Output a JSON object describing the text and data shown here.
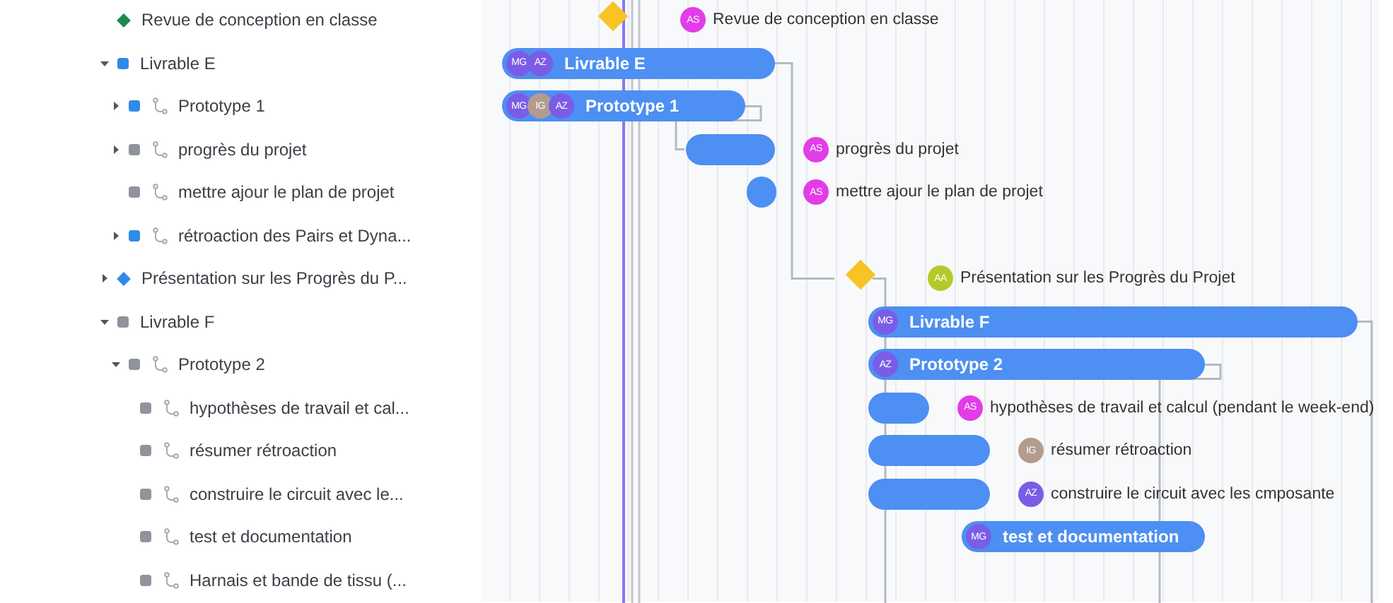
{
  "tree": [
    {
      "label": "Revue de conception en classe",
      "kind": "milestone",
      "color": "#1f8a4c"
    },
    {
      "label": "Livrable E",
      "kind": "group",
      "color": "#2e8be8",
      "expanded": true,
      "children": [
        {
          "label": "Prototype 1",
          "kind": "task",
          "color": "#2e8be8",
          "expanded": false
        },
        {
          "label": "progrès du projet",
          "kind": "task",
          "color": "#8f939b",
          "expanded": false
        },
        {
          "label": "mettre ajour le plan de projet",
          "kind": "task",
          "color": "#8f939b"
        },
        {
          "label": "rétroaction des Pairs et Dyna...",
          "kind": "task",
          "color": "#2e8be8",
          "expanded": false
        }
      ]
    },
    {
      "label": "Présentation sur les Progrès du P...",
      "kind": "milestone",
      "color": "#2e8be8",
      "expanded": false
    },
    {
      "label": "Livrable F",
      "kind": "group",
      "color": "#8f939b",
      "expanded": true,
      "children": [
        {
          "label": "Prototype 2",
          "kind": "task",
          "color": "#8f939b",
          "expanded": true,
          "children": [
            {
              "label": "hypothèses de travail et cal...",
              "kind": "task",
              "color": "#8f939b"
            },
            {
              "label": "résumer rétroaction",
              "kind": "task",
              "color": "#8f939b"
            },
            {
              "label": "construire le circuit avec le...",
              "kind": "task",
              "color": "#8f939b"
            },
            {
              "label": "test et documentation",
              "kind": "task",
              "color": "#8f939b"
            },
            {
              "label": "Harnais et bande de tissu (...",
              "kind": "task",
              "color": "#8f939b"
            }
          ]
        }
      ]
    }
  ],
  "timeline": {
    "rows": [
      {
        "kind": "milestone",
        "label": "Revue de conception en classe",
        "avatars": [
          {
            "initials": "AS",
            "color": "#e23de8"
          }
        ]
      },
      {
        "kind": "summary",
        "label": "Livrable E",
        "avatars": [
          {
            "initials": "MG",
            "color": "#7a5de6"
          },
          {
            "initials": "AZ",
            "color": "#7a5de6"
          }
        ]
      },
      {
        "kind": "summary",
        "label": "Prototype 1",
        "avatars": [
          {
            "initials": "MG",
            "color": "#7a5de6"
          },
          {
            "initials": "IG",
            "color": "#b39c8e"
          },
          {
            "initials": "AZ",
            "color": "#7a5de6"
          }
        ]
      },
      {
        "kind": "bar",
        "label": "progrès du projet",
        "avatars": [
          {
            "initials": "AS",
            "color": "#e23de8"
          }
        ]
      },
      {
        "kind": "dot",
        "label": "mettre ajour le plan de projet",
        "avatars": [
          {
            "initials": "AS",
            "color": "#e23de8"
          }
        ]
      },
      {
        "kind": "empty"
      },
      {
        "kind": "milestone",
        "label": "Présentation sur les Progrès du Projet",
        "avatars": [
          {
            "initials": "AA",
            "color": "#b5c92b"
          }
        ]
      },
      {
        "kind": "summary",
        "label": "Livrable F",
        "avatars": [
          {
            "initials": "MG",
            "color": "#7a5de6"
          }
        ]
      },
      {
        "kind": "summary",
        "label": "Prototype 2",
        "avatars": [
          {
            "initials": "AZ",
            "color": "#7a5de6"
          }
        ]
      },
      {
        "kind": "bar",
        "label": "hypothèses de travail et calcul (pendant le week-end)",
        "avatars": [
          {
            "initials": "AS",
            "color": "#e23de8"
          }
        ]
      },
      {
        "kind": "bar",
        "label": "résumer rétroaction",
        "avatars": [
          {
            "initials": "IG",
            "color": "#b39c8e"
          }
        ]
      },
      {
        "kind": "bar",
        "label": "construire le circuit avec les cmposante",
        "avatars": [
          {
            "initials": "AZ",
            "color": "#7a5de6"
          }
        ]
      },
      {
        "kind": "summary",
        "label": "test et documentation",
        "avatars": [
          {
            "initials": "MG",
            "color": "#7a5de6"
          }
        ]
      },
      {
        "kind": "empty"
      }
    ]
  }
}
